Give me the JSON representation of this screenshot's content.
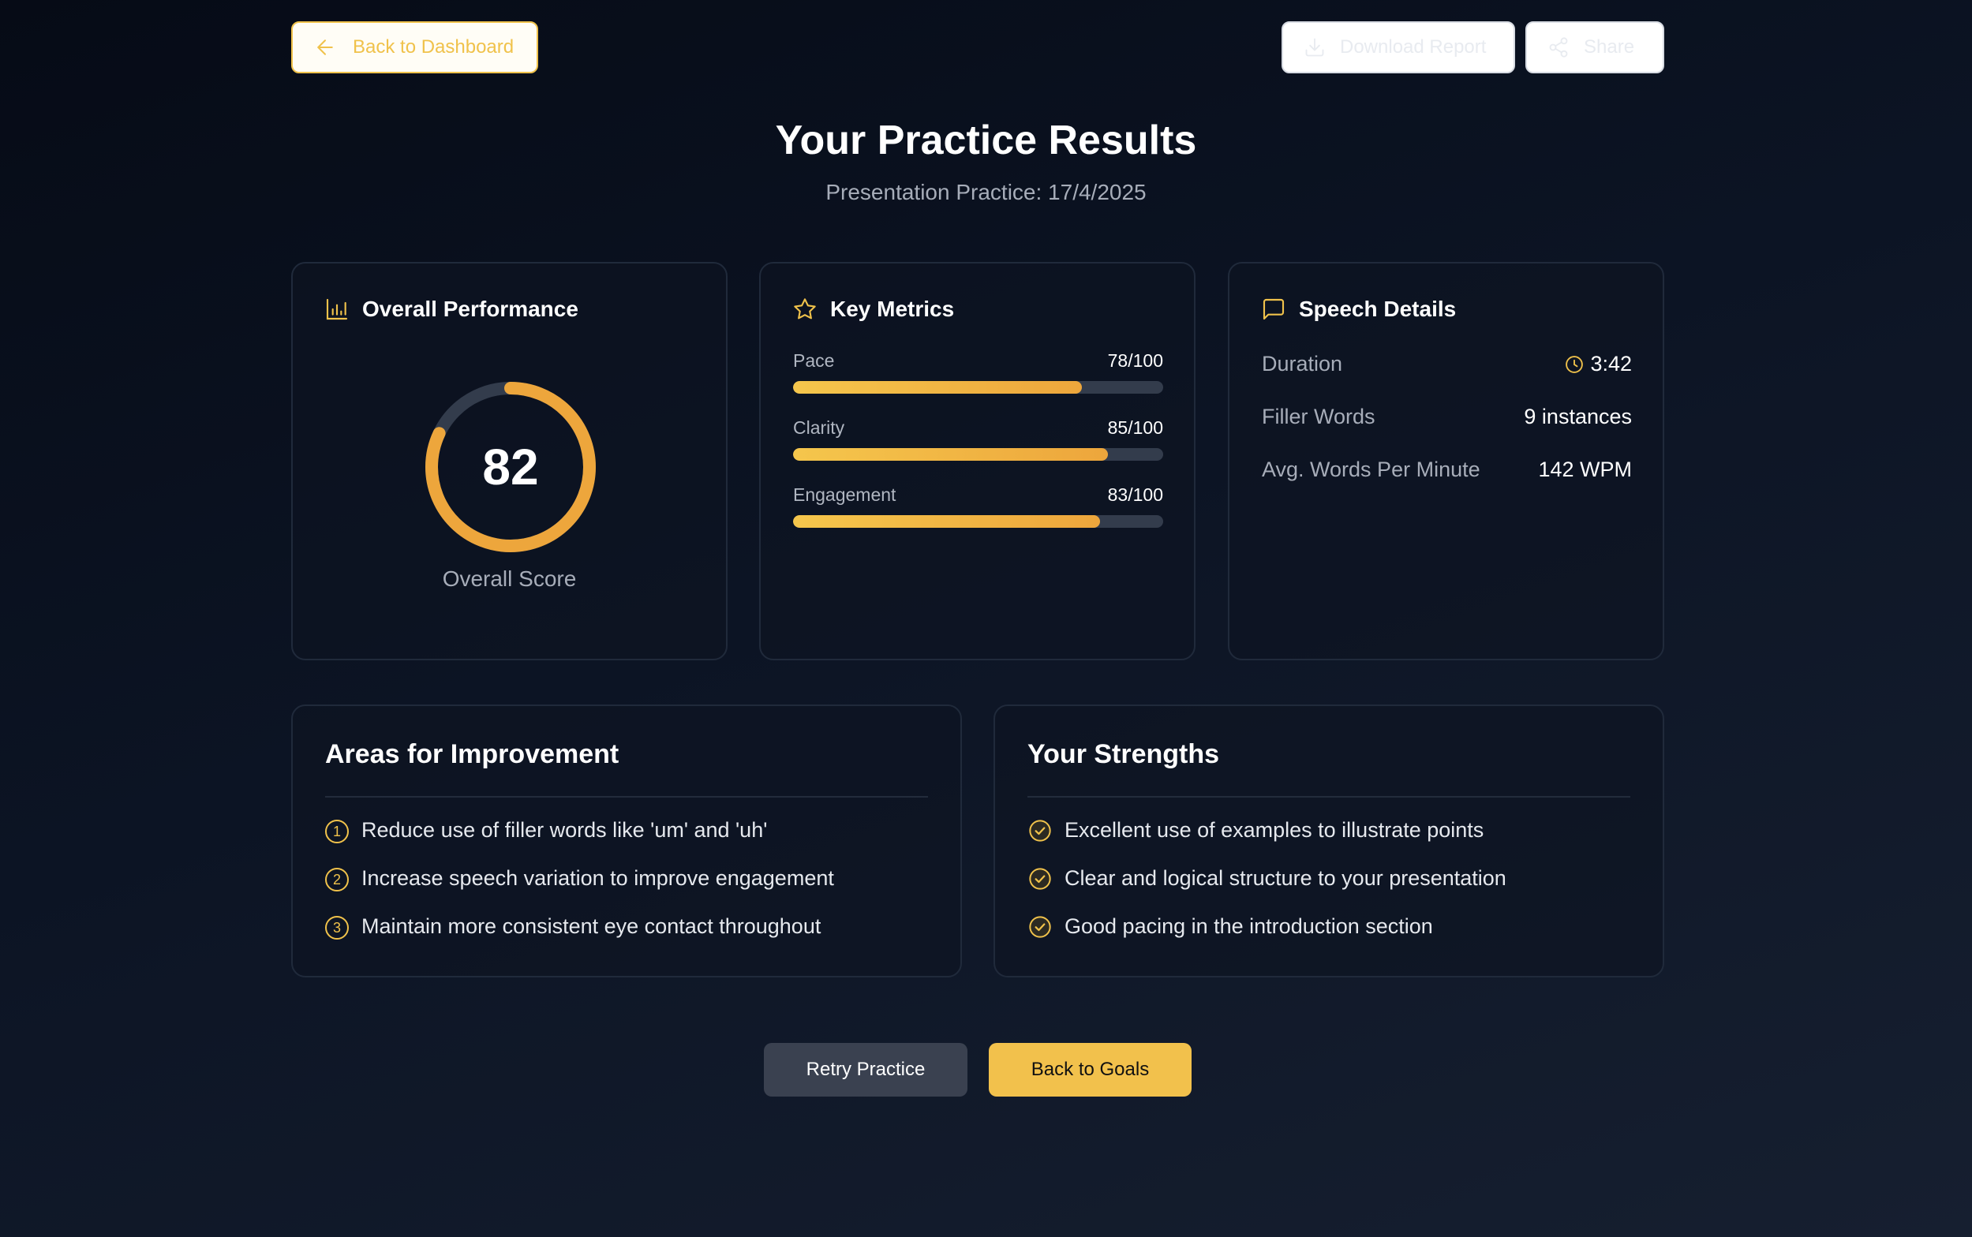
{
  "header": {
    "back_dashboard_label": "Back to Dashboard",
    "download_label": "Download Report",
    "share_label": "Share"
  },
  "page": {
    "title": "Your Practice Results",
    "subtitle": "Presentation Practice: 17/4/2025"
  },
  "performance": {
    "heading": "Overall Performance",
    "score": "82",
    "score_fraction": 0.82,
    "score_label": "Overall Score"
  },
  "metrics": {
    "heading": "Key Metrics",
    "items": [
      {
        "name": "Pace",
        "value": "78/100",
        "fraction": 0.78
      },
      {
        "name": "Clarity",
        "value": "85/100",
        "fraction": 0.85
      },
      {
        "name": "Engagement",
        "value": "83/100",
        "fraction": 0.83
      }
    ]
  },
  "speech": {
    "heading": "Speech Details",
    "items": [
      {
        "name": "Duration",
        "value": "3:42"
      },
      {
        "name": "Filler Words",
        "value": "9 instances"
      },
      {
        "name": "Avg. Words Per Minute",
        "value": "142 WPM"
      }
    ]
  },
  "improvement": {
    "heading": "Areas for Improvement",
    "items": [
      {
        "num": "1",
        "text": "Reduce use of filler words like 'um' and 'uh'"
      },
      {
        "num": "2",
        "text": "Increase speech variation to improve engagement"
      },
      {
        "num": "3",
        "text": "Maintain more consistent eye contact throughout"
      }
    ]
  },
  "strengths": {
    "heading": "Your Strengths",
    "items": [
      {
        "text": "Excellent use of examples to illustrate points"
      },
      {
        "text": "Clear and logical structure to your presentation"
      },
      {
        "text": "Good pacing in the introduction section"
      }
    ]
  },
  "actions": {
    "retry_label": "Retry Practice",
    "goals_label": "Back to Goals"
  },
  "colors": {
    "accent": "#f0c24b",
    "gauge_stroke": "#eda63c",
    "track": "#333c4c"
  },
  "icons": {
    "back": "arrow-left-icon",
    "download": "download-icon",
    "share": "share-icon",
    "performance": "bar-chart-icon",
    "metrics": "star-icon",
    "speech": "message-square-icon",
    "duration": "clock-icon",
    "strength": "check-circle-icon"
  }
}
